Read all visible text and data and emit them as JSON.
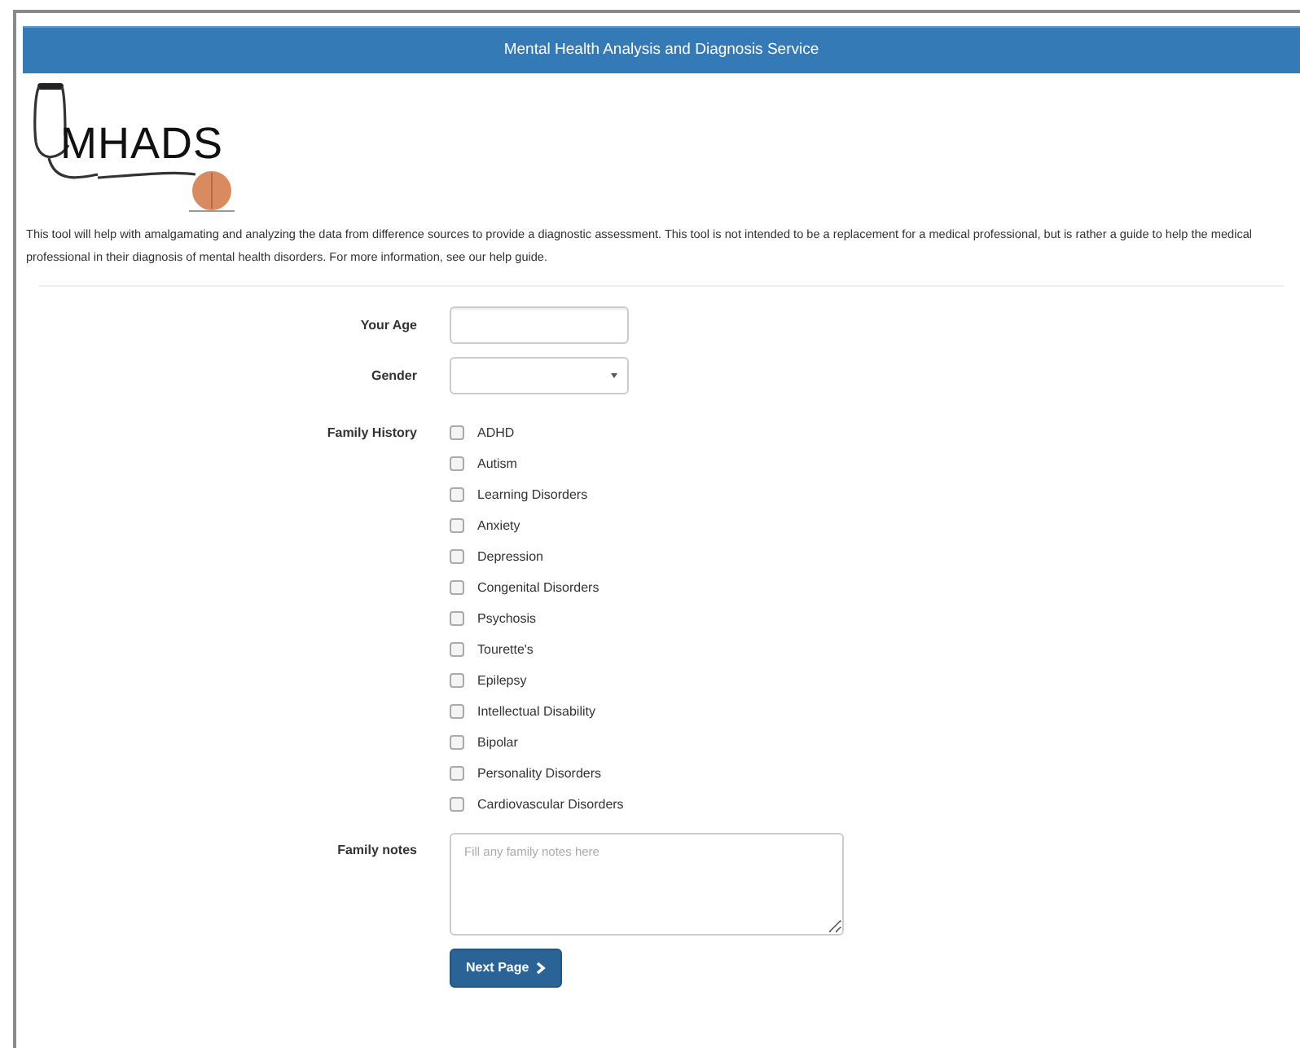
{
  "header": {
    "title": "Mental Health Analysis and Diagnosis Service"
  },
  "logo": {
    "text": "MHADS"
  },
  "intro": "This tool will help with amalgamating and analyzing the data from difference sources to provide a diagnostic assessment. This tool is not intended to be a replacement for a medical professional, but is rather a guide to help the medical professional in their diagnosis of mental health disorders. For more information, see our help guide.",
  "form": {
    "age": {
      "label": "Your Age"
    },
    "gender": {
      "label": "Gender"
    },
    "family_history": {
      "label": "Family History",
      "options": [
        {
          "label": "ADHD",
          "checked": false
        },
        {
          "label": "Autism",
          "checked": false
        },
        {
          "label": "Learning Disorders",
          "checked": false
        },
        {
          "label": "Anxiety",
          "checked": false
        },
        {
          "label": "Depression",
          "checked": false
        },
        {
          "label": "Congenital Disorders",
          "checked": false
        },
        {
          "label": "Psychosis",
          "checked": false
        },
        {
          "label": "Tourette's",
          "checked": false
        },
        {
          "label": "Epilepsy",
          "checked": false
        },
        {
          "label": "Intellectual Disability",
          "checked": false
        },
        {
          "label": "Bipolar",
          "checked": false
        },
        {
          "label": "Personality Disorders",
          "checked": false
        },
        {
          "label": "Cardiovascular Disorders",
          "checked": false
        }
      ]
    },
    "family_notes": {
      "label": "Family notes",
      "placeholder": "Fill any family notes here"
    },
    "next_button": {
      "label": "Next Page"
    }
  }
}
